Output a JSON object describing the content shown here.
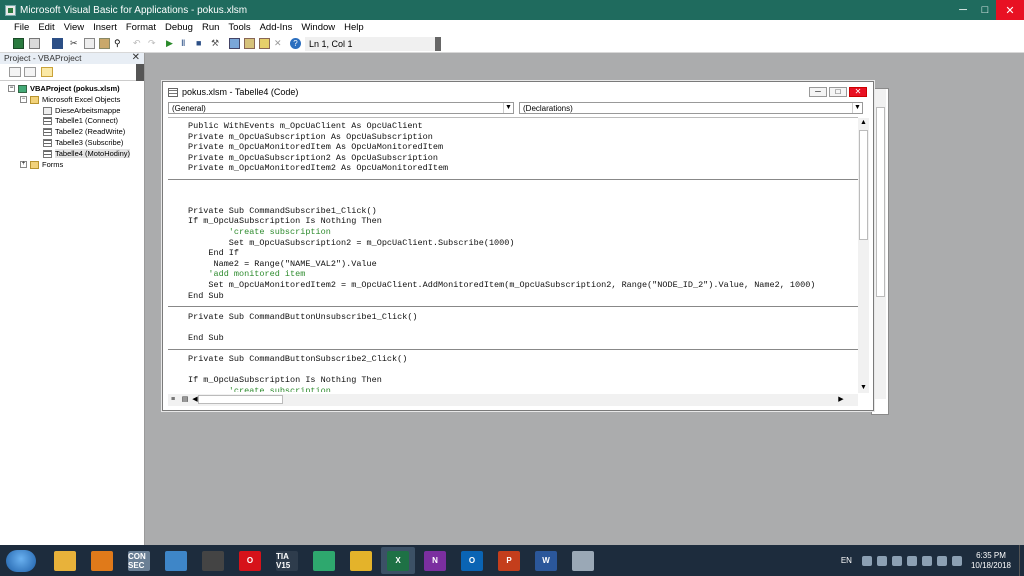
{
  "window": {
    "title": "Microsoft Visual Basic for Applications - pokus.xlsm",
    "minimize_icon": "minimize-icon",
    "maximize_icon": "maximize-icon",
    "close_icon": "close-icon"
  },
  "menu": [
    "File",
    "Edit",
    "View",
    "Insert",
    "Format",
    "Debug",
    "Run",
    "Tools",
    "Add-Ins",
    "Window",
    "Help"
  ],
  "toolbar": {
    "icons": [
      "excel-view-icon",
      "insert-module-icon",
      "save-icon",
      "cut-icon",
      "copy-icon",
      "paste-icon",
      "find-icon",
      "undo-icon",
      "redo-icon",
      "run-icon",
      "break-icon",
      "reset-icon",
      "design-mode-icon",
      "project-explorer-icon",
      "properties-icon",
      "object-browser-icon",
      "toolbox-icon",
      "help-icon"
    ],
    "position": "Ln 1, Col 1"
  },
  "project": {
    "title": "Project - VBAProject",
    "close": "✕",
    "tree": [
      {
        "label": "VBAProject (pokus.xlsm)",
        "icon": "project-icon",
        "toggle": "−",
        "bold": true,
        "indent": 0
      },
      {
        "label": "Microsoft Excel Objects",
        "icon": "folder-icon",
        "toggle": "−",
        "indent": 1
      },
      {
        "label": "DieseArbeitsmappe",
        "icon": "workbook-icon",
        "indent": 2
      },
      {
        "label": "Tabelle1 (Connect)",
        "icon": "sheet-icon",
        "indent": 2
      },
      {
        "label": "Tabelle2 (ReadWrite)",
        "icon": "sheet-icon",
        "indent": 2
      },
      {
        "label": "Tabelle3 (Subscribe)",
        "icon": "sheet-icon",
        "indent": 2
      },
      {
        "label": "Tabelle4 (MotoHodiny)",
        "icon": "sheet-icon",
        "indent": 2,
        "selected": true
      },
      {
        "label": "Forms",
        "icon": "folder-icon",
        "toggle": "+",
        "indent": 1
      }
    ]
  },
  "code_window": {
    "title": "pokus.xlsm - Tabelle4 (Code)",
    "object_combo": "(General)",
    "proc_combo": "(Declarations)",
    "lines": [
      {
        "text": "Public WithEvents m_OpcUaClient As OpcUaClient",
        "kind": "plain"
      },
      {
        "text": "Private m_OpcUaSubscription As OpcUaSubscription",
        "kind": "plain"
      },
      {
        "text": "Private m_OpcUaMonitoredItem As OpcUaMonitoredItem",
        "kind": "plain"
      },
      {
        "text": "Private m_OpcUaSubscription2 As OpcUaSubscription",
        "kind": "plain"
      },
      {
        "text": "Private m_OpcUaMonitoredItem2 As OpcUaMonitoredItem",
        "kind": "plain"
      },
      {
        "text": "",
        "kind": "sep"
      },
      {
        "text": "",
        "kind": "plain"
      },
      {
        "text": "",
        "kind": "plain"
      },
      {
        "text": "Private Sub CommandSubscribe1_Click()",
        "kind": "plain"
      },
      {
        "text": "If m_OpcUaSubscription Is Nothing Then",
        "kind": "plain"
      },
      {
        "text": "        'create subscription",
        "kind": "cm"
      },
      {
        "text": "        Set m_OpcUaSubscription2 = m_OpcUaClient.Subscribe(1000)",
        "kind": "plain"
      },
      {
        "text": "    End If",
        "kind": "plain"
      },
      {
        "text": "     Name2 = Range(\"NAME_VAL2\").Value",
        "kind": "plain"
      },
      {
        "text": "    'add monitored item",
        "kind": "cm"
      },
      {
        "text": "    Set m_OpcUaMonitoredItem2 = m_OpcUaClient.AddMonitoredItem(m_OpcUaSubscription2, Range(\"NODE_ID_2\").Value, Name2, 1000)",
        "kind": "plain"
      },
      {
        "text": "End Sub",
        "kind": "plain"
      },
      {
        "text": "",
        "kind": "sep"
      },
      {
        "text": "Private Sub CommandButtonUnsubscribe1_Click()",
        "kind": "plain"
      },
      {
        "text": "",
        "kind": "plain"
      },
      {
        "text": "End Sub",
        "kind": "plain"
      },
      {
        "text": "",
        "kind": "sep"
      },
      {
        "text": "Private Sub CommandButtonSubscribe2_Click()",
        "kind": "plain"
      },
      {
        "text": "",
        "kind": "plain"
      },
      {
        "text": "If m_OpcUaSubscription Is Nothing Then",
        "kind": "plain"
      },
      {
        "text": "        'create subscription",
        "kind": "cm"
      }
    ]
  },
  "taskbar": {
    "apps": [
      {
        "name": "file-explorer-icon",
        "label": "",
        "color": "#e8b23a"
      },
      {
        "name": "media-player-icon",
        "label": "",
        "color": "#e07a1a"
      },
      {
        "name": "connect-icon",
        "label": "CON SEC",
        "color": "#6a7f95"
      },
      {
        "name": "remote-desktop-icon",
        "label": "",
        "color": "#3e86c8"
      },
      {
        "name": "inkscape-icon",
        "label": "",
        "color": "#444444"
      },
      {
        "name": "opera-icon",
        "label": "O",
        "color": "#d6121a"
      },
      {
        "name": "tia-portal-icon",
        "label": "TIA V15",
        "color": "#2e3c4c"
      },
      {
        "name": "network-icon",
        "label": "",
        "color": "#2ea86e"
      },
      {
        "name": "chrome-icon",
        "label": "",
        "color": "#e4b32a"
      },
      {
        "name": "excel-icon",
        "label": "X",
        "color": "#1e7145"
      },
      {
        "name": "onenote-icon",
        "label": "N",
        "color": "#7b2fa0"
      },
      {
        "name": "outlook-icon",
        "label": "O",
        "color": "#0a64b4"
      },
      {
        "name": "powerpoint-icon",
        "label": "P",
        "color": "#c43e1c"
      },
      {
        "name": "word-icon",
        "label": "W",
        "color": "#2b579a"
      },
      {
        "name": "paint-icon",
        "label": "",
        "color": "#9aa8b6"
      }
    ],
    "language": "EN",
    "time": "6:35 PM",
    "date": "10/18/2018"
  }
}
